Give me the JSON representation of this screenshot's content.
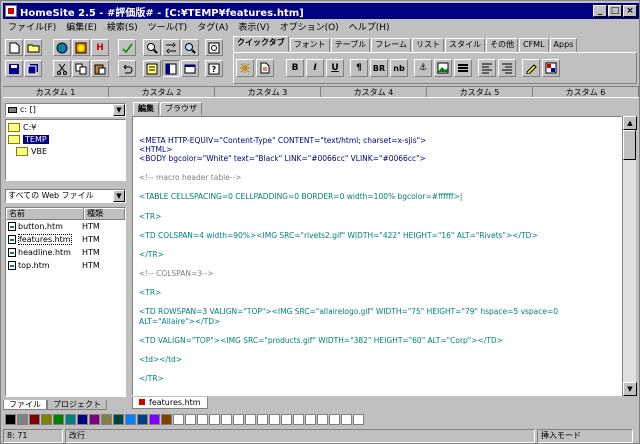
{
  "window": {
    "title": "HomeSite 2.5 - #評価版# - [C:¥TEMP¥features.htm]",
    "minimize": "_",
    "maximize": "□",
    "close": "×"
  },
  "menu": [
    "ファイル(F)",
    "編集(E)",
    "検索(S)",
    "ツール(T)",
    "タグ(A)",
    "表示(V)",
    "オプション(O)",
    "ヘルプ(H)"
  ],
  "quicktabs": [
    "クイックタブ",
    "フォント",
    "テーブル",
    "フレーム",
    "リスト",
    "スタイル",
    "その他",
    "CFML",
    "Apps"
  ],
  "quickbar": {
    "bold": "B",
    "italic": "I",
    "underline": "U",
    "para": "¶",
    "br": "BR",
    "nb": "nb",
    "anchor": "⚓"
  },
  "custom": [
    "カスタム 1",
    "カスタム 2",
    "カスタム 3",
    "カスタム 4",
    "カスタム 5",
    "カスタム 6"
  ],
  "drive": "c: []",
  "tree": [
    {
      "label": "C:¥",
      "indent": 0,
      "selected": false
    },
    {
      "label": "TEMP",
      "indent": 1,
      "selected": true
    },
    {
      "label": "VBE",
      "indent": 2,
      "selected": false
    }
  ],
  "filter": "すべての Web ファイル",
  "files": {
    "headers": [
      "名前",
      "種類"
    ],
    "rows": [
      {
        "name": "button.htm",
        "type": "HTM"
      },
      {
        "name": "features.htm",
        "type": "HTM"
      },
      {
        "name": "headline.htm",
        "type": "HTM"
      },
      {
        "name": "top.htm",
        "type": "HTM"
      }
    ]
  },
  "lefttabs": [
    "ファイル",
    "プロジェクト"
  ],
  "editortabs": [
    "編集",
    "ブラウザ"
  ],
  "code": [
    {
      "text": "<META HTTP-EQUIV=\"Content-Type\" CONTENT=\"text/html; charset=x-sjis\">",
      "color": "#000080"
    },
    {
      "text": "<HTML>",
      "color": "#000080"
    },
    {
      "text": "<BODY bgcolor=\"White\" text=\"Black\" LINK=\"#0066cc\" VLINK=\"#0066cc\">",
      "color": "#000080"
    },
    {
      "text": "<!-- macro header table-->",
      "color": "#808080"
    },
    {
      "text": "<TABLE CELLSPACING=0 CELLPADDING=0 BORDER=0 width=100% bgcolor=#ffffff>|",
      "color": "#008080"
    },
    {
      "text": "<TR>",
      "color": "#008080"
    },
    {
      "text": "        <TD COLSPAN=4 width=90%><IMG SRC=\"rivets2.gif\" WIDTH=\"422\" HEIGHT=\"16\" ALT=\"Rivets\"></TD>",
      "color": "#008080"
    },
    {
      "text": "</TR>",
      "color": "#008080"
    },
    {
      "text": "<!-- COLSPAN=3-->",
      "color": "#808080"
    },
    {
      "text": "<TR>",
      "color": "#008080"
    },
    {
      "text": "        <TD ROWSPAN=3 VALIGN=\"TOP\"><IMG SRC=\"allairelogo.gif\" WIDTH=\"75\" HEIGHT=\"79\" hspace=5 vspace=0",
      "color": "#008080"
    },
    {
      "text": "ALT=\"Allaire\"></TD>",
      "color": "#008080"
    },
    {
      "text": "        <TD VALIGN=\"TOP\"><IMG SRC=\"products.gif\" WIDTH=\"382\" HEIGHT=\"60\" ALT=\"Corp\"></TD>",
      "color": "#008080"
    },
    {
      "text": "        <td></td>",
      "color": "#008080"
    },
    {
      "text": "</TR>",
      "color": "#008080"
    }
  ],
  "doctab": "features.htm",
  "palette": [
    "#000000",
    "#808080",
    "#800000",
    "#808000",
    "#008000",
    "#008080",
    "#000080",
    "#800080",
    "#808040",
    "#004040",
    "#0080ff",
    "#004080",
    "#8000ff",
    "#804000",
    "#ffffff",
    "#ffffff",
    "#ffffff",
    "#ffffff",
    "#ffffff",
    "#ffffff",
    "#ffffff",
    "#ffffff",
    "#ffffff",
    "#ffffff",
    "#ffffff",
    "#ffffff",
    "#ffffff",
    "#ffffff",
    "#ffffff",
    "#ffffff"
  ],
  "status": {
    "pos": "8: 71",
    "mode": "改行",
    "insert": "挿入モード"
  }
}
